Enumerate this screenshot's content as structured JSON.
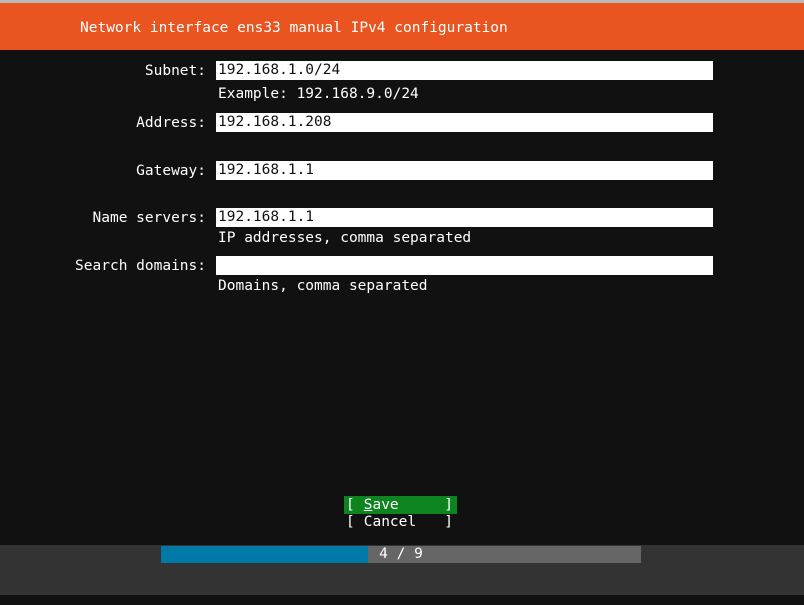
{
  "header": {
    "title": "Network interface ens33 manual IPv4 configuration",
    "background": "#e95420",
    "foreground": "#ffffff"
  },
  "form": {
    "fields": [
      {
        "label": "Subnet:",
        "value": "192.168.1.0/24",
        "placeholder": "",
        "hint": "Example: 192.168.9.0/24"
      },
      {
        "label": "Address:",
        "value": "192.168.1.208",
        "placeholder": "",
        "hint": ""
      },
      {
        "label": "Gateway:",
        "value": "192.168.1.1",
        "placeholder": "",
        "hint": ""
      },
      {
        "label": "Name servers:",
        "value": "192.168.1.1",
        "placeholder": "",
        "hint": "IP addresses, comma separated"
      },
      {
        "label": "Search domains:",
        "value": "",
        "placeholder": "",
        "hint": "Domains, comma separated"
      }
    ]
  },
  "buttons": {
    "save": {
      "bracket_left": "[",
      "bracket_right": "]",
      "accel": "S",
      "rest": "ave",
      "label": "Save",
      "focused": true,
      "background": "#0e8420"
    },
    "cancel": {
      "bracket_left": "[",
      "bracket_right": "]",
      "label": "Cancel",
      "focused": false
    }
  },
  "progress": {
    "text": "4 / 9",
    "current": 4,
    "total": 9,
    "fill_color": "#0079a8",
    "track_color": "#666666"
  }
}
